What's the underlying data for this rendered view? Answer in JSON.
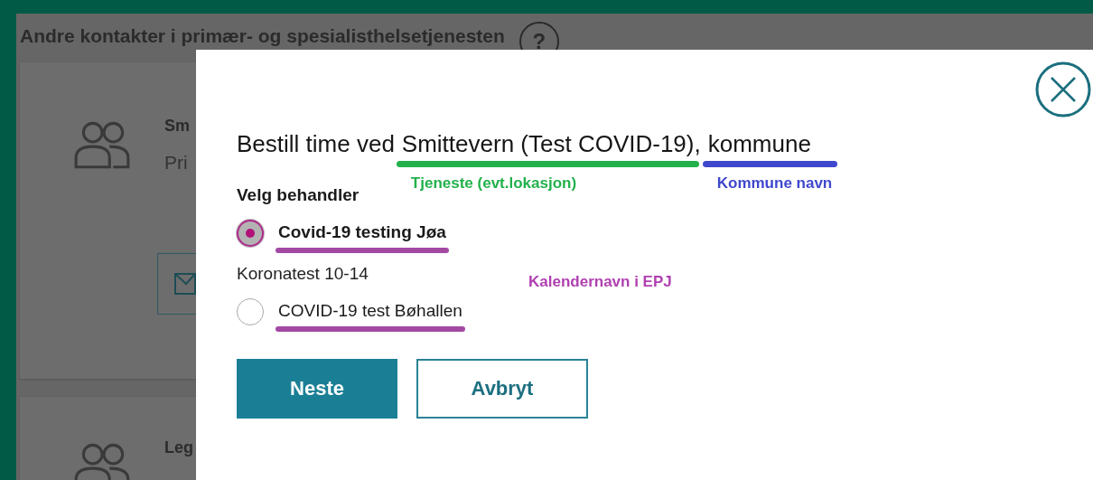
{
  "background_page": {
    "section_title": "Andre kontakter i primær- og spesialisthelsetjenesten",
    "help": "?",
    "cards": [
      {
        "name": "Sm",
        "description": "Pri",
        "has_button": true
      },
      {
        "name": "Leg"
      }
    ]
  },
  "modal": {
    "heading": [
      {
        "kind": "text",
        "text": "Bestill time ved"
      },
      {
        "kind": "annotated",
        "text": "Smittevern (Test COVID-19)",
        "annotation": {
          "label": "Tjeneste (evt.lokasjon)",
          "color": "#22b14c"
        }
      },
      {
        "kind": "punct",
        "text": ","
      },
      {
        "kind": "annotated",
        "text": "kommune",
        "annotation": {
          "label": "Kommune navn",
          "color": "#3f48cc"
        }
      }
    ],
    "group_label": "Velg behandler",
    "options": [
      {
        "label": "Covid-19 testing Jøa",
        "sublabel": "Koronatest 10-14",
        "selected": true,
        "underline": {
          "color": "#a349a4"
        }
      },
      {
        "label": "COVID-19 test Bøhallen",
        "selected": false,
        "underline": {
          "color": "#a349a4"
        }
      }
    ],
    "options_annotation": {
      "label": "Kalendernavn i EPJ",
      "color": "#b040b0"
    },
    "buttons": [
      {
        "kind": "primary",
        "label": "Neste"
      },
      {
        "kind": "secondary",
        "label": "Avbryt"
      }
    ]
  }
}
